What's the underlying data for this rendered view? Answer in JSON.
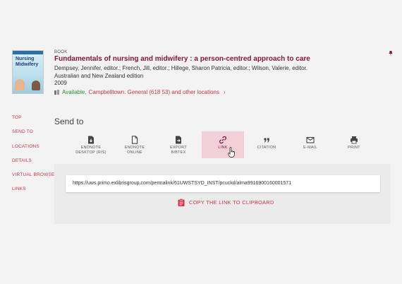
{
  "record": {
    "type": "BOOK",
    "title": "Fundamentals of nursing and midwifery : a person-centred approach to care",
    "authors": "Dempsey, Jennifer, editor.; French, Jill, editor.; Hillege, Sharon Patricia, editor.; Wilson, Valerie, editor.",
    "edition": "Australian and New Zealand edition",
    "year": "2009",
    "availability": {
      "status": "Available,",
      "location": "Campbelltown. General (618 53) and other locations"
    },
    "cover": {
      "title_line1": "Nursing",
      "title_line2": "Midwifery"
    }
  },
  "side_nav": [
    "TOP",
    "SEND TO",
    "LOCATIONS",
    "DETAILS",
    "VIRTUAL BROWSE",
    "LINKS"
  ],
  "send_to": {
    "heading": "Send to",
    "actions": [
      {
        "line1": "ENDNOTE",
        "line2": "DESKTOP (RIS)",
        "icon": "file-download-icon"
      },
      {
        "line1": "ENDNOTE",
        "line2": "ONLINE",
        "icon": "file-icon"
      },
      {
        "line1": "EXPORT",
        "line2": "BIBTEX",
        "icon": "file-export-icon"
      },
      {
        "line1": "LINK",
        "line2": "",
        "icon": "link-icon",
        "active": true
      },
      {
        "line1": "CITATION",
        "line2": "",
        "icon": "quote-icon"
      },
      {
        "line1": "E-MAIL",
        "line2": "",
        "icon": "mail-icon"
      },
      {
        "line1": "PRINT",
        "line2": "",
        "icon": "printer-icon"
      }
    ],
    "permalink": "https://uws.primo.exlibrisgroup.com/permalink/61UWSTSYD_INST/pcuckd/alma9916900160001571",
    "copy_label": "COPY THE LINK TO CLIPBOARD"
  },
  "colors": {
    "accent": "#d1334e",
    "title": "#8a1538",
    "available": "#2e8b3a",
    "active_bg": "#f2d0d7"
  }
}
